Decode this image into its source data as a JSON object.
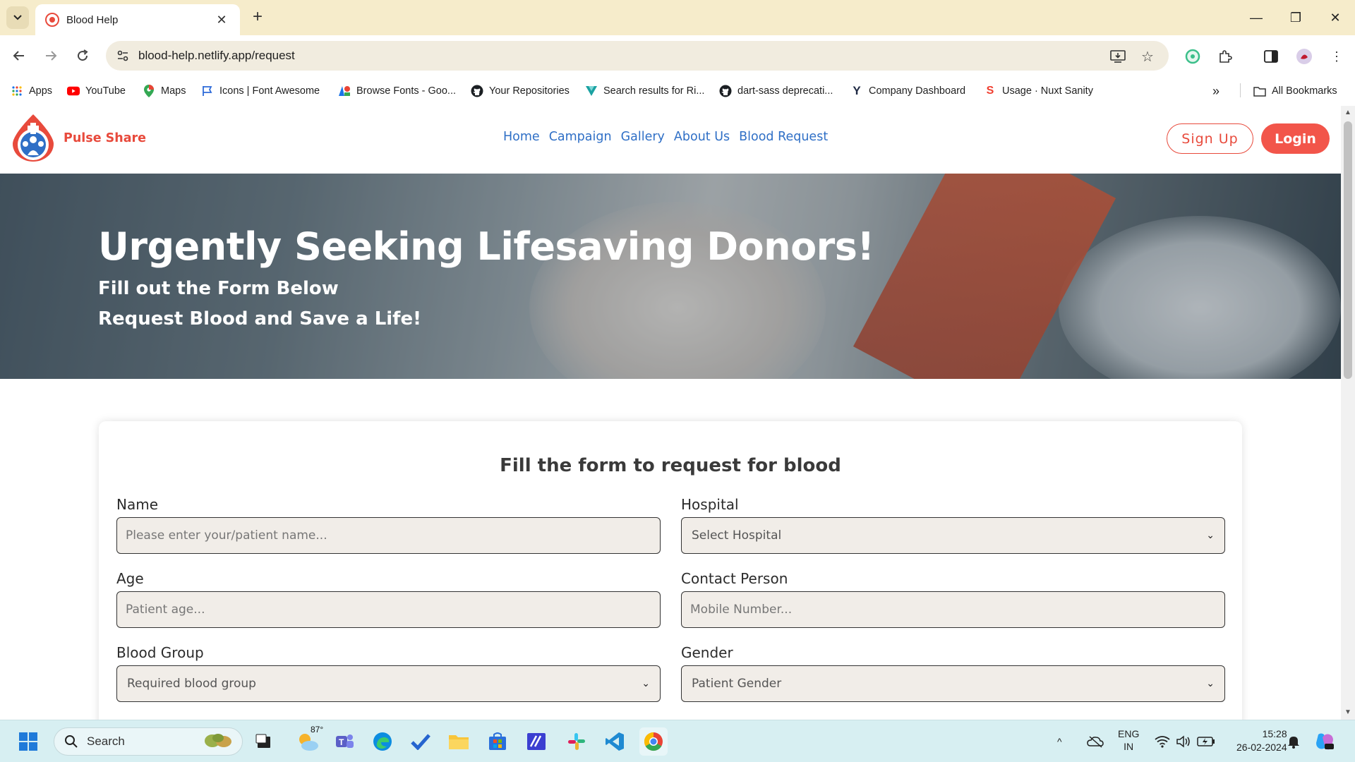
{
  "browser": {
    "tab_title": "Blood Help",
    "url": "blood-help.netlify.app/request",
    "bookmarks": [
      {
        "label": "Apps",
        "icon": "apps-grid-icon"
      },
      {
        "label": "YouTube",
        "icon": "youtube-icon"
      },
      {
        "label": "Maps",
        "icon": "maps-pin-icon"
      },
      {
        "label": "Icons | Font Awesome",
        "icon": "font-awesome-flag-icon"
      },
      {
        "label": "Browse Fonts - Goo...",
        "icon": "google-fonts-icon"
      },
      {
        "label": "Your Repositories",
        "icon": "github-icon"
      },
      {
        "label": "Search results for Ri...",
        "icon": "vuetify-icon"
      },
      {
        "label": "dart-sass deprecati...",
        "icon": "github-icon"
      },
      {
        "label": "Company Dashboard",
        "icon": "ycombinator-icon"
      },
      {
        "label": "Usage · Nuxt Sanity",
        "icon": "sanity-icon"
      }
    ],
    "all_bookmarks": "All Bookmarks"
  },
  "site": {
    "brand": "Pulse Share",
    "nav": [
      "Home",
      "Campaign",
      "Gallery",
      "About Us",
      "Blood Request"
    ],
    "signup": "Sign Up",
    "login": "Login"
  },
  "hero": {
    "title": "Urgently Seeking Lifesaving Donors!",
    "line1": "Fill out the Form Below",
    "line2": "Request Blood and Save a Life!"
  },
  "form": {
    "title": "Fill the form to request for blood",
    "fields": [
      {
        "label": "Name",
        "placeholder": "Please enter your/patient name..."
      },
      {
        "label": "Hospital",
        "value": "Select Hospital"
      },
      {
        "label": "Age",
        "placeholder": "Patient age..."
      },
      {
        "label": "Contact Person",
        "placeholder": "Mobile Number..."
      },
      {
        "label": "Blood Group",
        "value": "Required blood group"
      },
      {
        "label": "Gender",
        "value": "Patient Gender"
      }
    ]
  },
  "taskbar": {
    "search_label": "Search",
    "weather": "87°",
    "lang1": "ENG",
    "lang2": "IN",
    "time": "15:28",
    "date": "26-02-2024"
  },
  "colors": {
    "brand_red": "#e84a3c",
    "nav_blue": "#2f6fc6",
    "title_bar": "#f6eccb",
    "taskbar": "#d7eff2"
  }
}
